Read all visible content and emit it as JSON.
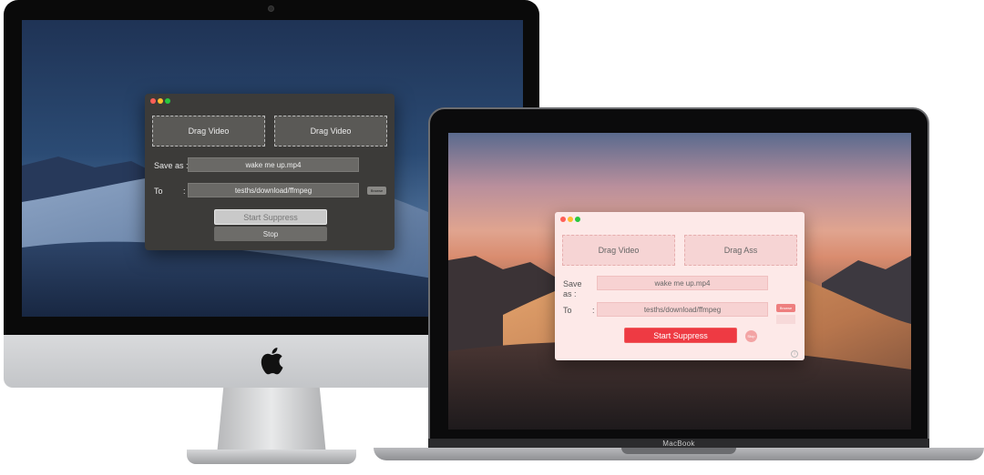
{
  "imac": {
    "window": {
      "drop_zone_1": "Drag Video",
      "drop_zone_2": "Drag Video",
      "save_as_label": "Save as :",
      "save_as_value": "wake me up.mp4",
      "to_label": "To",
      "to_colon": ":",
      "to_value": "tesths/download/ffmpeg",
      "browse_label": "Browse",
      "start_label": "Start Suppress",
      "stop_label": "Stop"
    }
  },
  "macbook": {
    "brand": "MacBook",
    "window": {
      "drop_zone_1": "Drag Video",
      "drop_zone_2": "Drag Ass",
      "save_as_label_1": "Save",
      "save_as_label_2": "as :",
      "save_as_value": "wake me up.mp4",
      "to_label": "To",
      "to_colon": ":",
      "to_value": "tesths/download/ffmpeg",
      "browse_label": "Browse",
      "start_label": "Start Suppress",
      "stop_label": "Stop",
      "info_glyph": "i"
    }
  },
  "colors": {
    "dark_window_bg": "#3c3b39",
    "light_window_bg": "#fde9e8",
    "start_button_light": "#ee3a43"
  }
}
